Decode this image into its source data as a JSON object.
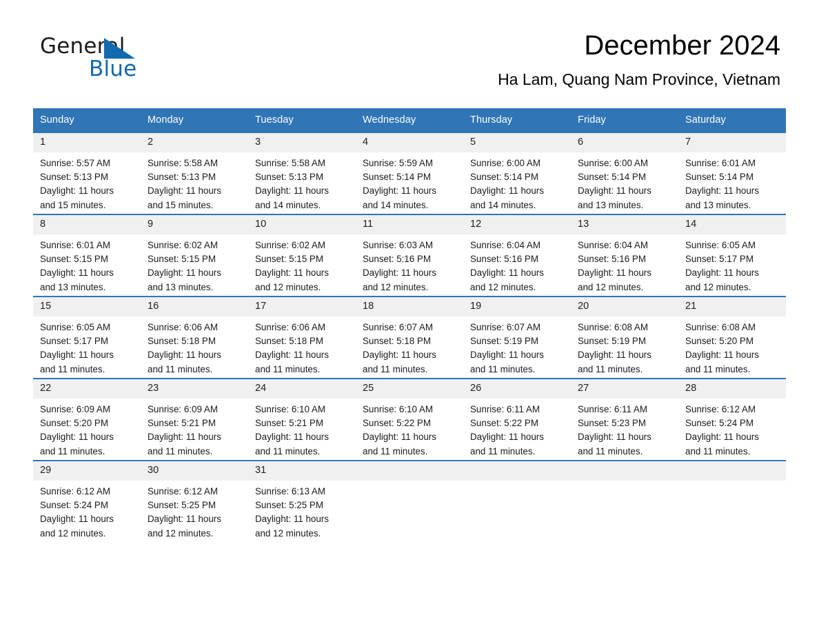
{
  "logo": {
    "word1": "General",
    "word2": "Blue",
    "triangle_color": "#1169b0",
    "icon": "triangle-logo-icon"
  },
  "header": {
    "title": "December 2024",
    "subtitle": "Ha Lam, Quang Nam Province, Vietnam"
  },
  "theme": {
    "header_blue": "#3075b5",
    "row_border_blue": "#3075b5",
    "daynum_band": "#f0f0f0",
    "text": "#1a1a1a"
  },
  "calendar": {
    "weekday_headers": [
      "Sunday",
      "Monday",
      "Tuesday",
      "Wednesday",
      "Thursday",
      "Friday",
      "Saturday"
    ],
    "weeks": [
      [
        {
          "day": "1",
          "sunrise": "Sunrise: 5:57 AM",
          "sunset": "Sunset: 5:13 PM",
          "daylight1": "Daylight: 11 hours",
          "daylight2": "and 15 minutes."
        },
        {
          "day": "2",
          "sunrise": "Sunrise: 5:58 AM",
          "sunset": "Sunset: 5:13 PM",
          "daylight1": "Daylight: 11 hours",
          "daylight2": "and 15 minutes."
        },
        {
          "day": "3",
          "sunrise": "Sunrise: 5:58 AM",
          "sunset": "Sunset: 5:13 PM",
          "daylight1": "Daylight: 11 hours",
          "daylight2": "and 14 minutes."
        },
        {
          "day": "4",
          "sunrise": "Sunrise: 5:59 AM",
          "sunset": "Sunset: 5:14 PM",
          "daylight1": "Daylight: 11 hours",
          "daylight2": "and 14 minutes."
        },
        {
          "day": "5",
          "sunrise": "Sunrise: 6:00 AM",
          "sunset": "Sunset: 5:14 PM",
          "daylight1": "Daylight: 11 hours",
          "daylight2": "and 14 minutes."
        },
        {
          "day": "6",
          "sunrise": "Sunrise: 6:00 AM",
          "sunset": "Sunset: 5:14 PM",
          "daylight1": "Daylight: 11 hours",
          "daylight2": "and 13 minutes."
        },
        {
          "day": "7",
          "sunrise": "Sunrise: 6:01 AM",
          "sunset": "Sunset: 5:14 PM",
          "daylight1": "Daylight: 11 hours",
          "daylight2": "and 13 minutes."
        }
      ],
      [
        {
          "day": "8",
          "sunrise": "Sunrise: 6:01 AM",
          "sunset": "Sunset: 5:15 PM",
          "daylight1": "Daylight: 11 hours",
          "daylight2": "and 13 minutes."
        },
        {
          "day": "9",
          "sunrise": "Sunrise: 6:02 AM",
          "sunset": "Sunset: 5:15 PM",
          "daylight1": "Daylight: 11 hours",
          "daylight2": "and 13 minutes."
        },
        {
          "day": "10",
          "sunrise": "Sunrise: 6:02 AM",
          "sunset": "Sunset: 5:15 PM",
          "daylight1": "Daylight: 11 hours",
          "daylight2": "and 12 minutes."
        },
        {
          "day": "11",
          "sunrise": "Sunrise: 6:03 AM",
          "sunset": "Sunset: 5:16 PM",
          "daylight1": "Daylight: 11 hours",
          "daylight2": "and 12 minutes."
        },
        {
          "day": "12",
          "sunrise": "Sunrise: 6:04 AM",
          "sunset": "Sunset: 5:16 PM",
          "daylight1": "Daylight: 11 hours",
          "daylight2": "and 12 minutes."
        },
        {
          "day": "13",
          "sunrise": "Sunrise: 6:04 AM",
          "sunset": "Sunset: 5:16 PM",
          "daylight1": "Daylight: 11 hours",
          "daylight2": "and 12 minutes."
        },
        {
          "day": "14",
          "sunrise": "Sunrise: 6:05 AM",
          "sunset": "Sunset: 5:17 PM",
          "daylight1": "Daylight: 11 hours",
          "daylight2": "and 12 minutes."
        }
      ],
      [
        {
          "day": "15",
          "sunrise": "Sunrise: 6:05 AM",
          "sunset": "Sunset: 5:17 PM",
          "daylight1": "Daylight: 11 hours",
          "daylight2": "and 11 minutes."
        },
        {
          "day": "16",
          "sunrise": "Sunrise: 6:06 AM",
          "sunset": "Sunset: 5:18 PM",
          "daylight1": "Daylight: 11 hours",
          "daylight2": "and 11 minutes."
        },
        {
          "day": "17",
          "sunrise": "Sunrise: 6:06 AM",
          "sunset": "Sunset: 5:18 PM",
          "daylight1": "Daylight: 11 hours",
          "daylight2": "and 11 minutes."
        },
        {
          "day": "18",
          "sunrise": "Sunrise: 6:07 AM",
          "sunset": "Sunset: 5:18 PM",
          "daylight1": "Daylight: 11 hours",
          "daylight2": "and 11 minutes."
        },
        {
          "day": "19",
          "sunrise": "Sunrise: 6:07 AM",
          "sunset": "Sunset: 5:19 PM",
          "daylight1": "Daylight: 11 hours",
          "daylight2": "and 11 minutes."
        },
        {
          "day": "20",
          "sunrise": "Sunrise: 6:08 AM",
          "sunset": "Sunset: 5:19 PM",
          "daylight1": "Daylight: 11 hours",
          "daylight2": "and 11 minutes."
        },
        {
          "day": "21",
          "sunrise": "Sunrise: 6:08 AM",
          "sunset": "Sunset: 5:20 PM",
          "daylight1": "Daylight: 11 hours",
          "daylight2": "and 11 minutes."
        }
      ],
      [
        {
          "day": "22",
          "sunrise": "Sunrise: 6:09 AM",
          "sunset": "Sunset: 5:20 PM",
          "daylight1": "Daylight: 11 hours",
          "daylight2": "and 11 minutes."
        },
        {
          "day": "23",
          "sunrise": "Sunrise: 6:09 AM",
          "sunset": "Sunset: 5:21 PM",
          "daylight1": "Daylight: 11 hours",
          "daylight2": "and 11 minutes."
        },
        {
          "day": "24",
          "sunrise": "Sunrise: 6:10 AM",
          "sunset": "Sunset: 5:21 PM",
          "daylight1": "Daylight: 11 hours",
          "daylight2": "and 11 minutes."
        },
        {
          "day": "25",
          "sunrise": "Sunrise: 6:10 AM",
          "sunset": "Sunset: 5:22 PM",
          "daylight1": "Daylight: 11 hours",
          "daylight2": "and 11 minutes."
        },
        {
          "day": "26",
          "sunrise": "Sunrise: 6:11 AM",
          "sunset": "Sunset: 5:22 PM",
          "daylight1": "Daylight: 11 hours",
          "daylight2": "and 11 minutes."
        },
        {
          "day": "27",
          "sunrise": "Sunrise: 6:11 AM",
          "sunset": "Sunset: 5:23 PM",
          "daylight1": "Daylight: 11 hours",
          "daylight2": "and 11 minutes."
        },
        {
          "day": "28",
          "sunrise": "Sunrise: 6:12 AM",
          "sunset": "Sunset: 5:24 PM",
          "daylight1": "Daylight: 11 hours",
          "daylight2": "and 11 minutes."
        }
      ],
      [
        {
          "day": "29",
          "sunrise": "Sunrise: 6:12 AM",
          "sunset": "Sunset: 5:24 PM",
          "daylight1": "Daylight: 11 hours",
          "daylight2": "and 12 minutes."
        },
        {
          "day": "30",
          "sunrise": "Sunrise: 6:12 AM",
          "sunset": "Sunset: 5:25 PM",
          "daylight1": "Daylight: 11 hours",
          "daylight2": "and 12 minutes."
        },
        {
          "day": "31",
          "sunrise": "Sunrise: 6:13 AM",
          "sunset": "Sunset: 5:25 PM",
          "daylight1": "Daylight: 11 hours",
          "daylight2": "and 12 minutes."
        },
        {
          "day": "",
          "sunrise": "",
          "sunset": "",
          "daylight1": "",
          "daylight2": ""
        },
        {
          "day": "",
          "sunrise": "",
          "sunset": "",
          "daylight1": "",
          "daylight2": ""
        },
        {
          "day": "",
          "sunrise": "",
          "sunset": "",
          "daylight1": "",
          "daylight2": ""
        },
        {
          "day": "",
          "sunrise": "",
          "sunset": "",
          "daylight1": "",
          "daylight2": ""
        }
      ]
    ]
  }
}
